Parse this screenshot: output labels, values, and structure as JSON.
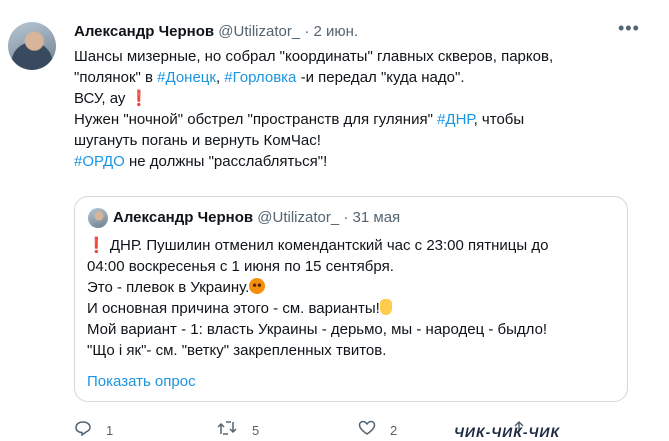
{
  "tweet": {
    "author_name": "Александр Чернов",
    "handle": "@Utilizator_",
    "separator": "·",
    "date": "2 июн.",
    "more_icon": "more-icon",
    "lines": {
      "l1": "Шансы мизерные, но собрал \"координаты\" главных скверов, парков,",
      "l2_a": "\"полянок\" в ",
      "l2_tag1": "#Донецк",
      "l2_b": ", ",
      "l2_tag2": "#Горловка",
      "l2_c": " -и передал \"куда надо\".",
      "l3_a": "ВСУ, ау ",
      "l3_excl": "❗",
      "l4_a": "Нужен \"ночной\" обстрел \"пространств для гуляния\" ",
      "l4_tag": "#ДНР",
      "l4_b": ", чтобы",
      "l5": "шугануть погань и вернуть КомЧас!",
      "l6_tag": "#ОРДО",
      "l6_b": " не должны \"расслабляться\"!"
    }
  },
  "quoted": {
    "author_name": "Александр Чернов",
    "handle": "@Utilizator_",
    "separator": "·",
    "date": "31 мая",
    "lines": {
      "l1_excl": "❗",
      "l1": " ДНР. Пушилин отменил комендантский час с 23:00 пятницы до",
      "l2": "04:00 воскресенья с 1 июня по 15 сентября.",
      "l3": "Это - плевок в Украину.",
      "l4": "И основная причина этого - см. варианты!",
      "l5": "Мой вариант - 1: власть Украины - дерьмо, мы - народец - быдло!",
      "l6": "\"Що і як\"- см. \"ветку\" закрепленных твитов."
    },
    "poll_link": "Показать опрос"
  },
  "actions": {
    "reply_count": "1",
    "retweet_count": "5",
    "like_count": "2"
  },
  "watermark": "ЧИК-ЧИК-ЧИК"
}
